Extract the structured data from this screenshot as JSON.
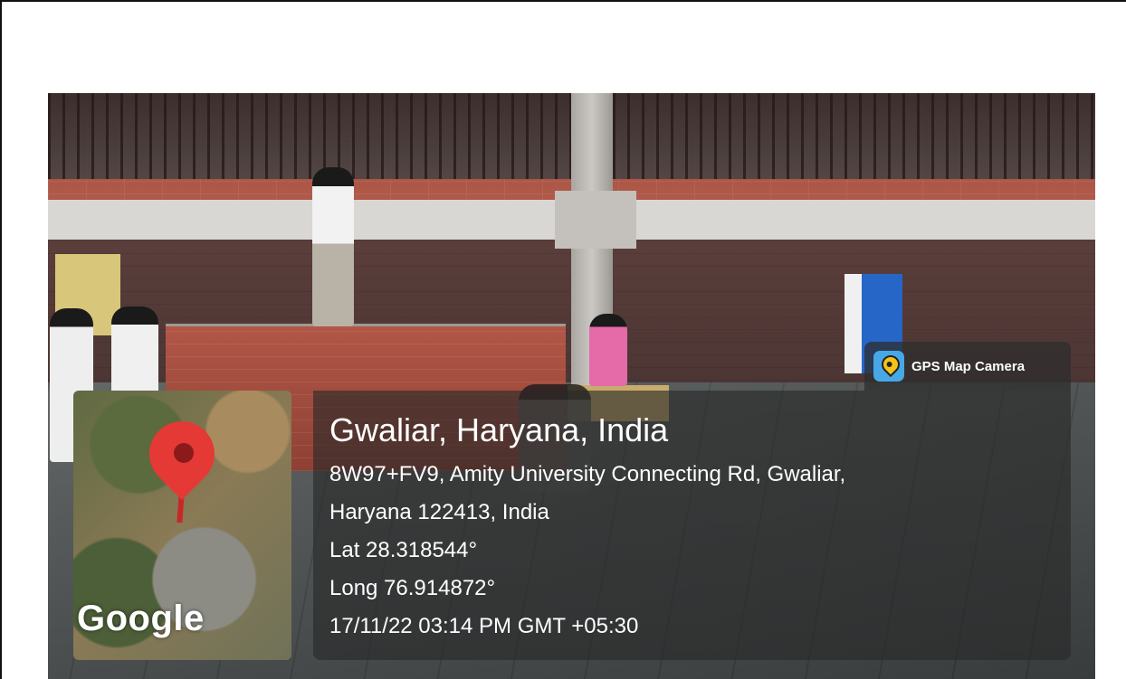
{
  "overlay": {
    "app_badge": {
      "label": "GPS Map Camera",
      "icon": "gps-map-camera-icon"
    },
    "map": {
      "logo_text": "Google",
      "pin_color": "#e53935"
    },
    "location": {
      "title": "Gwaliar, Haryana, India",
      "address_line_1": "8W97+FV9, Amity University Connecting Rd, Gwaliar,",
      "address_line_2": "Haryana 122413, India",
      "latitude": "Lat 28.318544°",
      "longitude": "Long 76.914872°",
      "timestamp": "17/11/22 03:14 PM GMT +05:30"
    }
  }
}
